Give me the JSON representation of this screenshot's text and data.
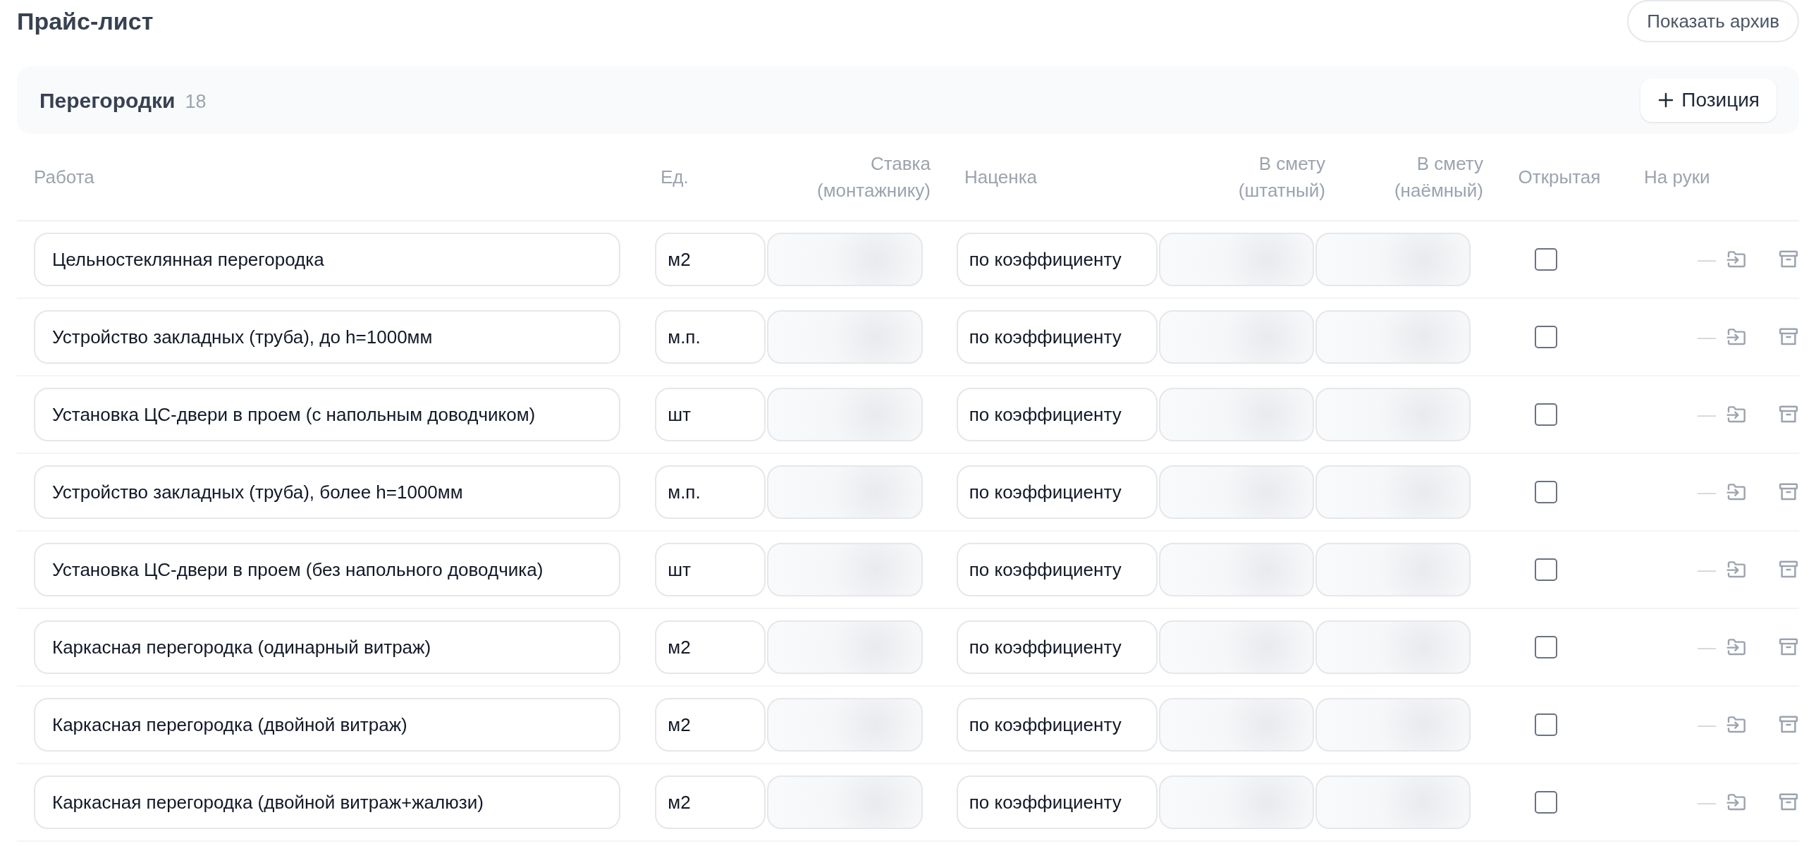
{
  "page": {
    "title": "Прайс-лист",
    "archive_button": "Показать архив"
  },
  "section": {
    "title": "Перегородки",
    "count": "18",
    "add_button": "Позиция"
  },
  "columns": [
    "Работа",
    "Ед.",
    "Ставка (монтажнику)",
    "Наценка",
    "В смету (штатный)",
    "В смету (наёмный)",
    "Открытая",
    "На руки"
  ],
  "rows": [
    {
      "work": "Цельностеклянная перегородка",
      "unit": "м2",
      "markup": "по коэффициенту",
      "open": false,
      "hands": "—"
    },
    {
      "work": "Устройство закладных (труба), до h=1000мм",
      "unit": "м.п.",
      "markup": "по коэффициенту",
      "open": false,
      "hands": "—"
    },
    {
      "work": "Установка ЦС-двери в проем (с напольным доводчиком)",
      "unit": "шт",
      "markup": "по коэффициенту",
      "open": false,
      "hands": "—"
    },
    {
      "work": "Устройство закладных (труба), более h=1000мм",
      "unit": "м.п.",
      "markup": "по коэффициенту",
      "open": false,
      "hands": "—"
    },
    {
      "work": "Установка ЦС-двери в проем (без напольного доводчика)",
      "unit": "шт",
      "markup": "по коэффициенту",
      "open": false,
      "hands": "—"
    },
    {
      "work": "Каркасная перегородка (одинарный витраж)",
      "unit": "м2",
      "markup": "по коэффициенту",
      "open": false,
      "hands": "—"
    },
    {
      "work": "Каркасная перегородка (двойной витраж)",
      "unit": "м2",
      "markup": "по коэффициенту",
      "open": false,
      "hands": "—"
    },
    {
      "work": "Каркасная перегородка (двойной витраж+жалюзи)",
      "unit": "м2",
      "markup": "по коэффициенту",
      "open": false,
      "hands": "—"
    }
  ]
}
